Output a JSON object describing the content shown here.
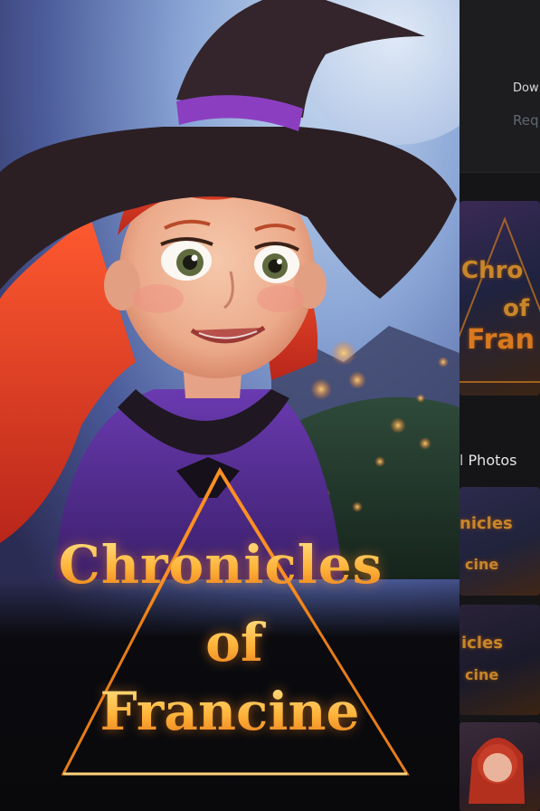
{
  "background_app": {
    "download_text": "Dow",
    "request_text": "Req",
    "photos_label": "Photos",
    "thumb_titles": [
      {
        "line1": "Chro",
        "line2": "of",
        "line3": "Fran"
      },
      {
        "line1": "nicles",
        "line2": "cine"
      },
      {
        "line1": "icles",
        "line2": "cine"
      }
    ]
  },
  "poster": {
    "title_line1": "Chronicles",
    "title_line2": "of",
    "title_line3": "Francine"
  },
  "colors": {
    "title_gradient_top": "#ffe38a",
    "title_gradient_bottom": "#e8781a",
    "glow": "#ff9a2a",
    "hat": "#2b1f24",
    "hat_band": "#8b3fc0",
    "hair": "#d8351c",
    "cape": "#4b2780"
  }
}
